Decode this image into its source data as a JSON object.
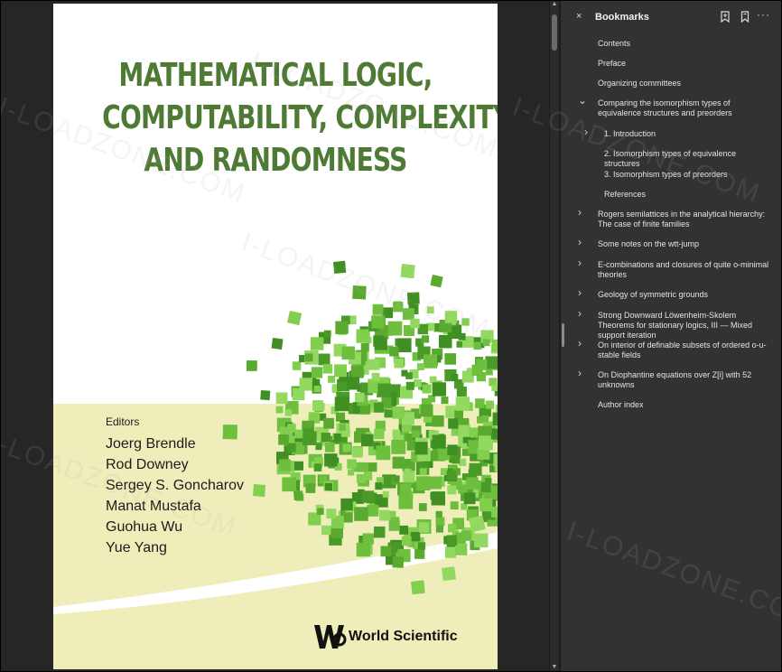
{
  "book": {
    "title_lines": [
      "MATHEMATICAL LOGIC,",
      "COMPUTABILITY, COMPLEXITY,",
      "AND RANDOMNESS"
    ],
    "editors_heading": "Editors",
    "editors": [
      "Joerg Brendle",
      "Rod Downey",
      "Sergey S. Goncharov",
      "Manat Mustafa",
      "Guohua Wu",
      "Yue Yang"
    ],
    "publisher": "World Scientific"
  },
  "panel": {
    "close_glyph": "×",
    "title": "Bookmarks",
    "icons": [
      "add-bookmark-icon",
      "bookmark-icon",
      "more-options-icon"
    ],
    "more_glyph": "···"
  },
  "bookmarks": [
    {
      "label": "Contents",
      "chevron": ""
    },
    {
      "label": "Preface",
      "chevron": ""
    },
    {
      "label": "Organizing committees",
      "chevron": ""
    },
    {
      "label": "Comparing the isomorphism types of equivalence structures and preorders",
      "chevron": "⌄"
    },
    {
      "label": "1. Introduction",
      "chevron": "›"
    },
    {
      "label": "2. Isomorphism types of equivalence structures",
      "chevron": ""
    },
    {
      "label": "3. Isomorphism types of preorders",
      "chevron": ""
    },
    {
      "label": "References",
      "chevron": ""
    },
    {
      "label": "Rogers semilattices in the analytical hierarchy: The case of finite families",
      "chevron": "›"
    },
    {
      "label": "Some notes on the wtt-jump",
      "chevron": "›"
    },
    {
      "label": "E-combinations and closures of quite o-minimal theories",
      "chevron": "›"
    },
    {
      "label": "Geology of symmetric grounds",
      "chevron": "›"
    },
    {
      "label": "Strong Downward Löwenheim-Skolem Theorems for stationary logics, III — Mixed support iteration",
      "chevron": "›"
    },
    {
      "label": "On interior of definable subsets of ordered o-u-stable fields",
      "chevron": "›"
    },
    {
      "label": "On Diophantine equations over Z[i] with 52 unknowns",
      "chevron": "›"
    },
    {
      "label": "Author index",
      "chevron": ""
    }
  ],
  "watermark": "I-LOADZONE.COM",
  "colors": {
    "title_green": "#4e7a34",
    "panel_bg": "#323232",
    "cover_yellow": "#efeebb"
  }
}
